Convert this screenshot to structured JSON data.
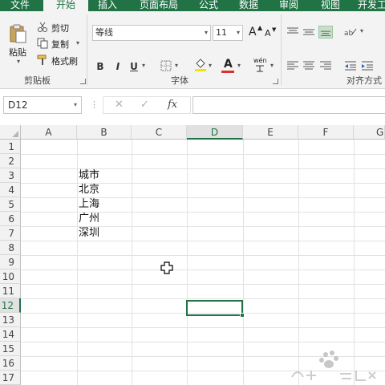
{
  "ribbon": {
    "tabs": [
      "文件",
      "开始",
      "插入",
      "页面布局",
      "公式",
      "数据",
      "审阅",
      "视图",
      "开发工"
    ],
    "active_tab": "开始",
    "clipboard": {
      "paste_label": "粘贴",
      "cut_label": "剪切",
      "copy_label": "复制",
      "format_painter_label": "格式刷",
      "group_label": "剪贴板"
    },
    "font": {
      "font_name": "等线",
      "font_size": "11",
      "grow_label": "A",
      "shrink_label": "A",
      "bold_label": "B",
      "italic_label": "I",
      "underline_label": "U",
      "font_color_label": "A",
      "phonetic_label": "wén",
      "group_label": "字体"
    },
    "alignment": {
      "group_label": "对齐方式"
    }
  },
  "formula_bar": {
    "name_box": "D12",
    "cancel_glyph": "✕",
    "enter_glyph": "✓",
    "fx_glyph": "fx",
    "formula": ""
  },
  "sheet": {
    "columns": [
      "A",
      "B",
      "C",
      "D",
      "E",
      "F",
      "G"
    ],
    "active_column": "D",
    "rows": [
      "1",
      "2",
      "3",
      "4",
      "5",
      "6",
      "7",
      "8",
      "9",
      "10",
      "11",
      "12",
      "13",
      "14",
      "15",
      "16",
      "17"
    ],
    "active_row": "12",
    "cells": {
      "B3": "城市",
      "B4": "北京",
      "B5": "上海",
      "B6": "广州",
      "B7": "深圳"
    },
    "selected_cell": "D12"
  },
  "colors": {
    "accent": "#217346",
    "ribbon_bg": "#f3f3f3",
    "header_bg": "#f2f2f2",
    "gridline": "#e2e2e2"
  },
  "icons": {
    "cursor": "cross-cursor-icon",
    "watermark": "baidu-watermark-icon"
  }
}
